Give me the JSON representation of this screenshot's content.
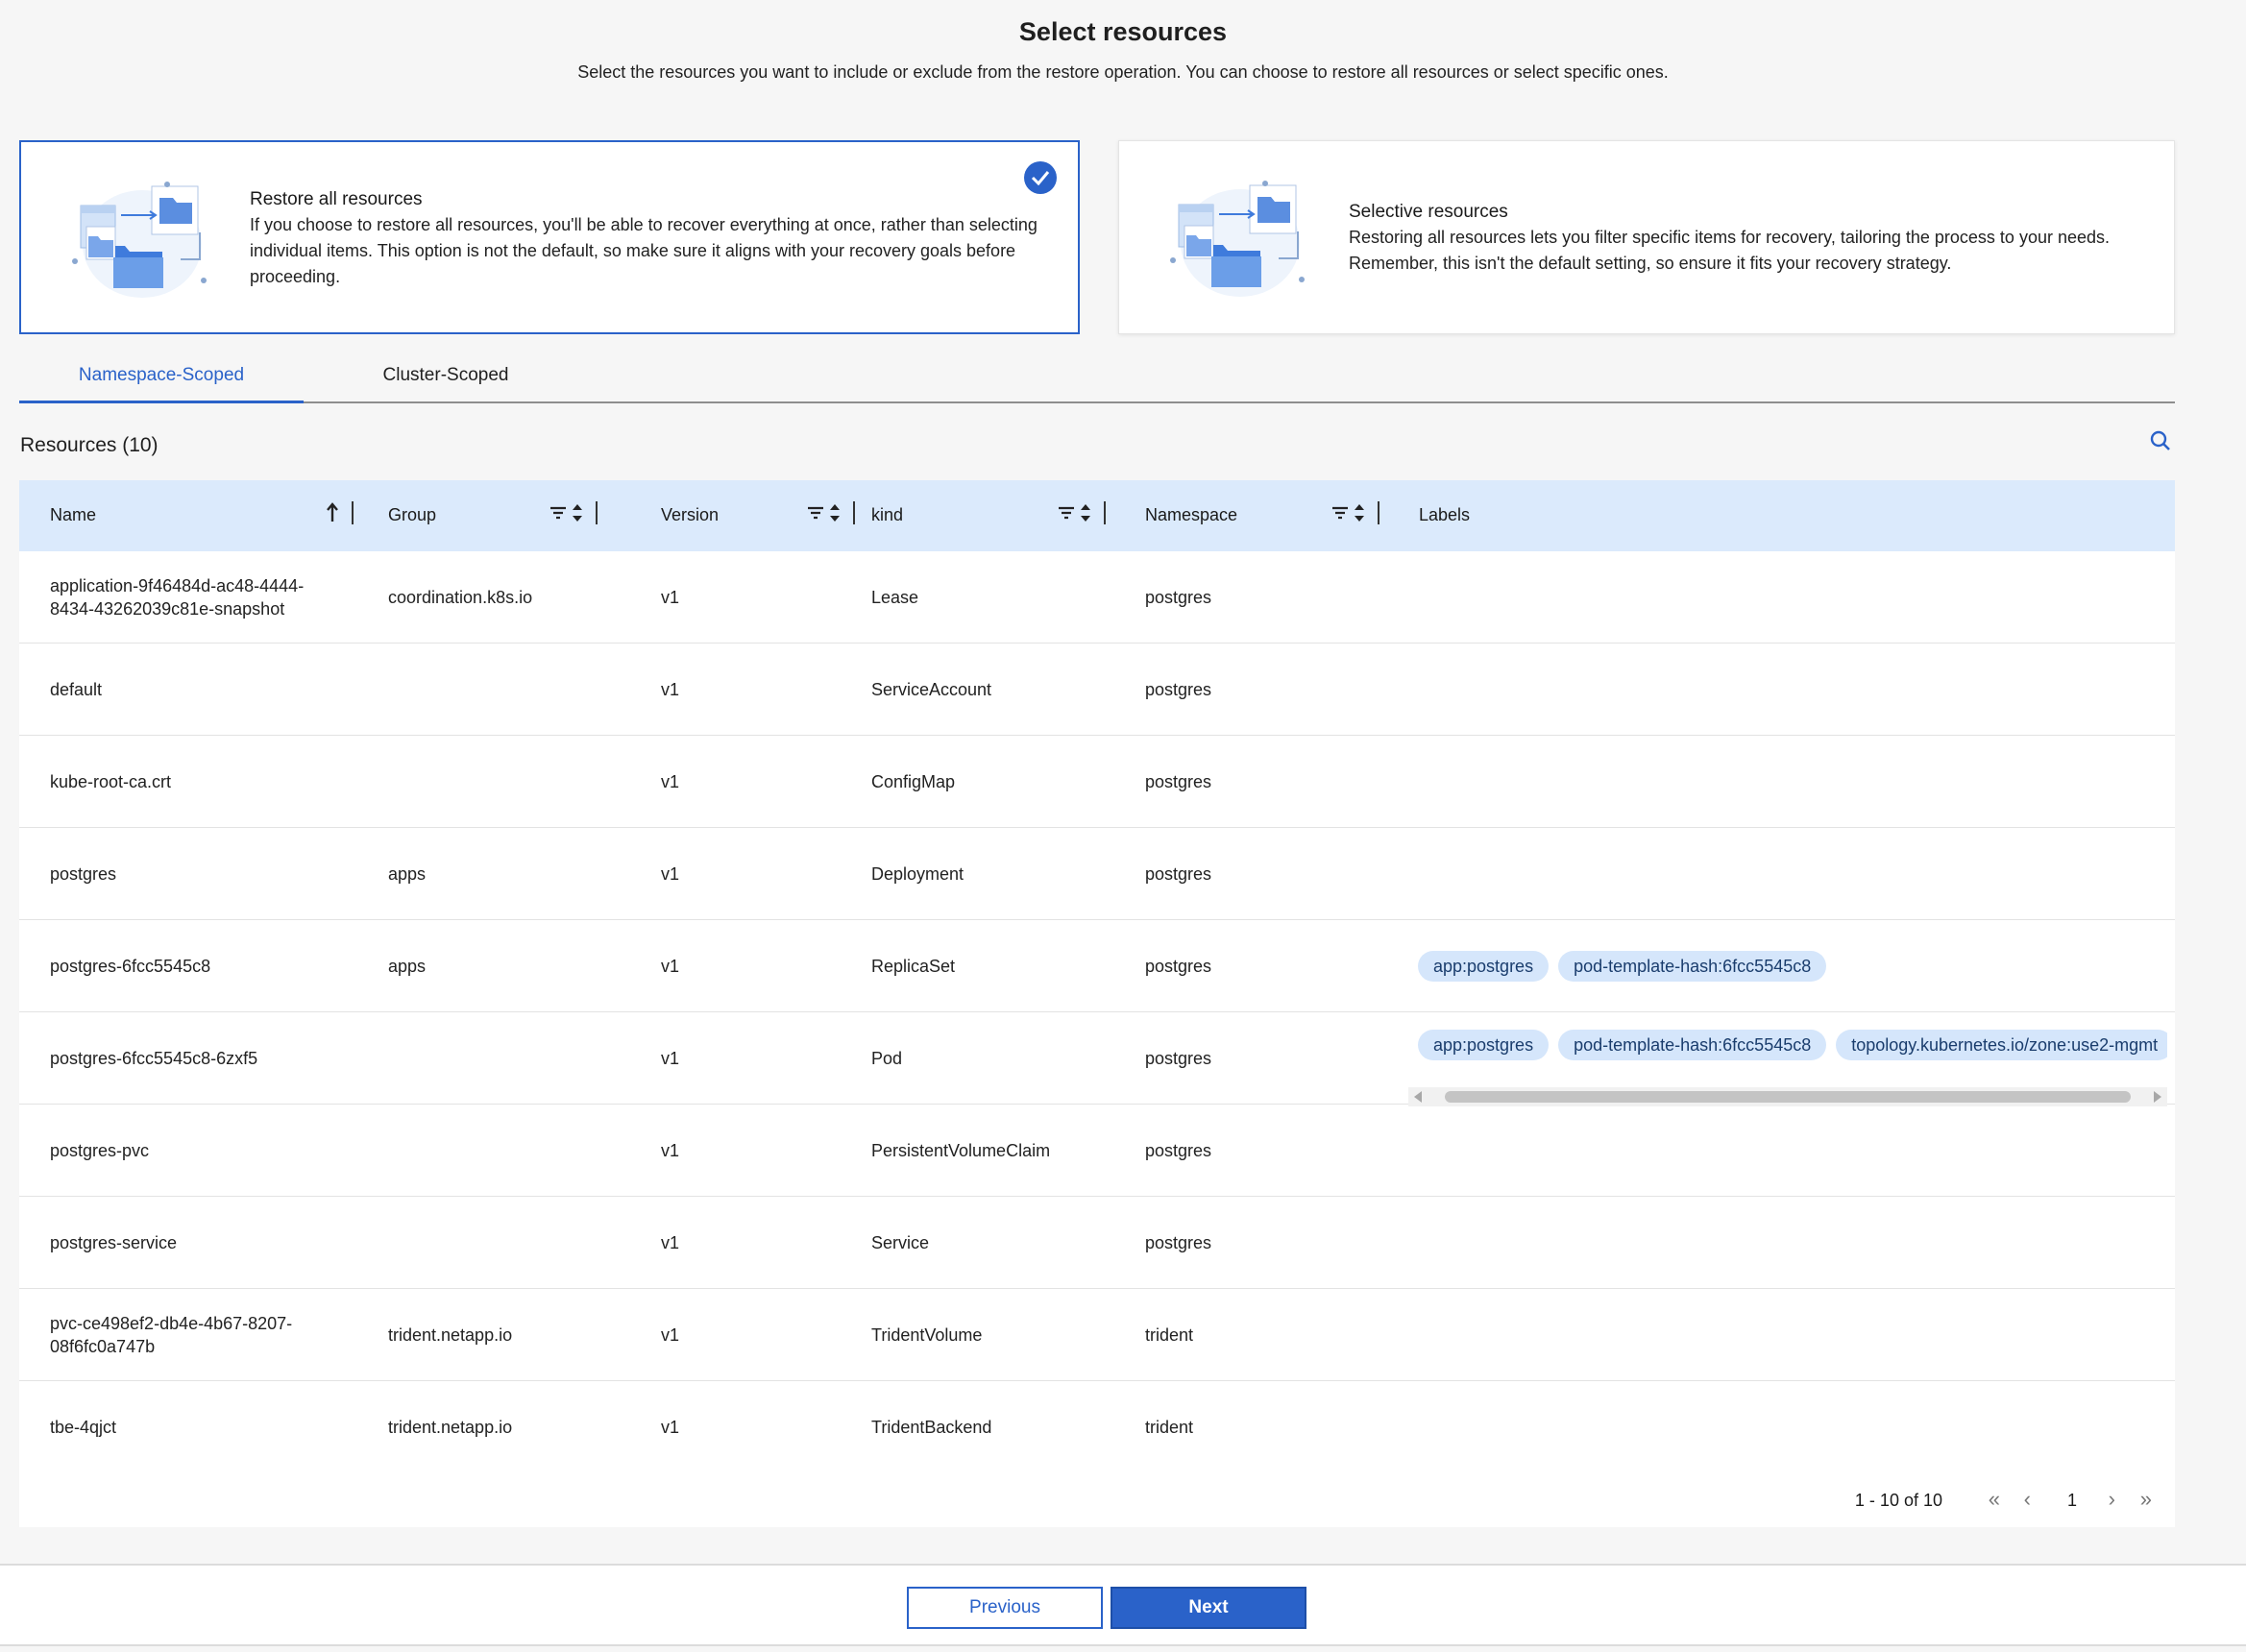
{
  "header": {
    "title": "Select resources",
    "subtitle": "Select the resources you want to include or exclude from the restore operation. You can choose to restore all resources or select specific ones."
  },
  "options": [
    {
      "title": "Restore all resources",
      "description": "If you choose to restore all resources, you'll be able to recover everything at once, rather than selecting individual items. This option is not the default, so make sure it aligns with your recovery goals before proceeding.",
      "selected": true
    },
    {
      "title": "Selective resources",
      "description": "Restoring all resources lets you filter specific items for recovery, tailoring the process to your needs. Remember, this isn't the default setting, so ensure it fits your recovery strategy.",
      "selected": false
    }
  ],
  "tabs": [
    {
      "label": "Namespace-Scoped",
      "active": true
    },
    {
      "label": "Cluster-Scoped",
      "active": false
    }
  ],
  "resources_title": "Resources (10)",
  "columns": {
    "name": "Name",
    "group": "Group",
    "version": "Version",
    "kind": "kind",
    "namespace": "Namespace",
    "labels": "Labels"
  },
  "rows": [
    {
      "name": "application-9f46484d-ac48-4444-8434-43262039c81e-snapshot",
      "group": "coordination.k8s.io",
      "version": "v1",
      "kind": "Lease",
      "namespace": "postgres",
      "labels": []
    },
    {
      "name": "default",
      "group": "",
      "version": "v1",
      "kind": "ServiceAccount",
      "namespace": "postgres",
      "labels": []
    },
    {
      "name": "kube-root-ca.crt",
      "group": "",
      "version": "v1",
      "kind": "ConfigMap",
      "namespace": "postgres",
      "labels": []
    },
    {
      "name": "postgres",
      "group": "apps",
      "version": "v1",
      "kind": "Deployment",
      "namespace": "postgres",
      "labels": []
    },
    {
      "name": "postgres-6fcc5545c8",
      "group": "apps",
      "version": "v1",
      "kind": "ReplicaSet",
      "namespace": "postgres",
      "labels": [
        "app:postgres",
        "pod-template-hash:6fcc5545c8"
      ]
    },
    {
      "name": "postgres-6fcc5545c8-6zxf5",
      "group": "",
      "version": "v1",
      "kind": "Pod",
      "namespace": "postgres",
      "labels": [
        "app:postgres",
        "pod-template-hash:6fcc5545c8",
        "topology.kubernetes.io/zone:use2-mgmt"
      ]
    },
    {
      "name": "postgres-pvc",
      "group": "",
      "version": "v1",
      "kind": "PersistentVolumeClaim",
      "namespace": "postgres",
      "labels": []
    },
    {
      "name": "postgres-service",
      "group": "",
      "version": "v1",
      "kind": "Service",
      "namespace": "postgres",
      "labels": []
    },
    {
      "name": "pvc-ce498ef2-db4e-4b67-8207-08f6fc0a747b",
      "group": "trident.netapp.io",
      "version": "v1",
      "kind": "TridentVolume",
      "namespace": "trident",
      "labels": []
    },
    {
      "name": "tbe-4qjct",
      "group": "trident.netapp.io",
      "version": "v1",
      "kind": "TridentBackend",
      "namespace": "trident",
      "labels": []
    }
  ],
  "pagination": {
    "range": "1 - 10 of 10",
    "page": "1"
  },
  "footer": {
    "previous_label": "Previous",
    "next_label": "Next"
  },
  "colors": {
    "accent": "#2a62c9",
    "header_bg": "#dbeafc",
    "chip_bg": "#d5e6fb"
  }
}
